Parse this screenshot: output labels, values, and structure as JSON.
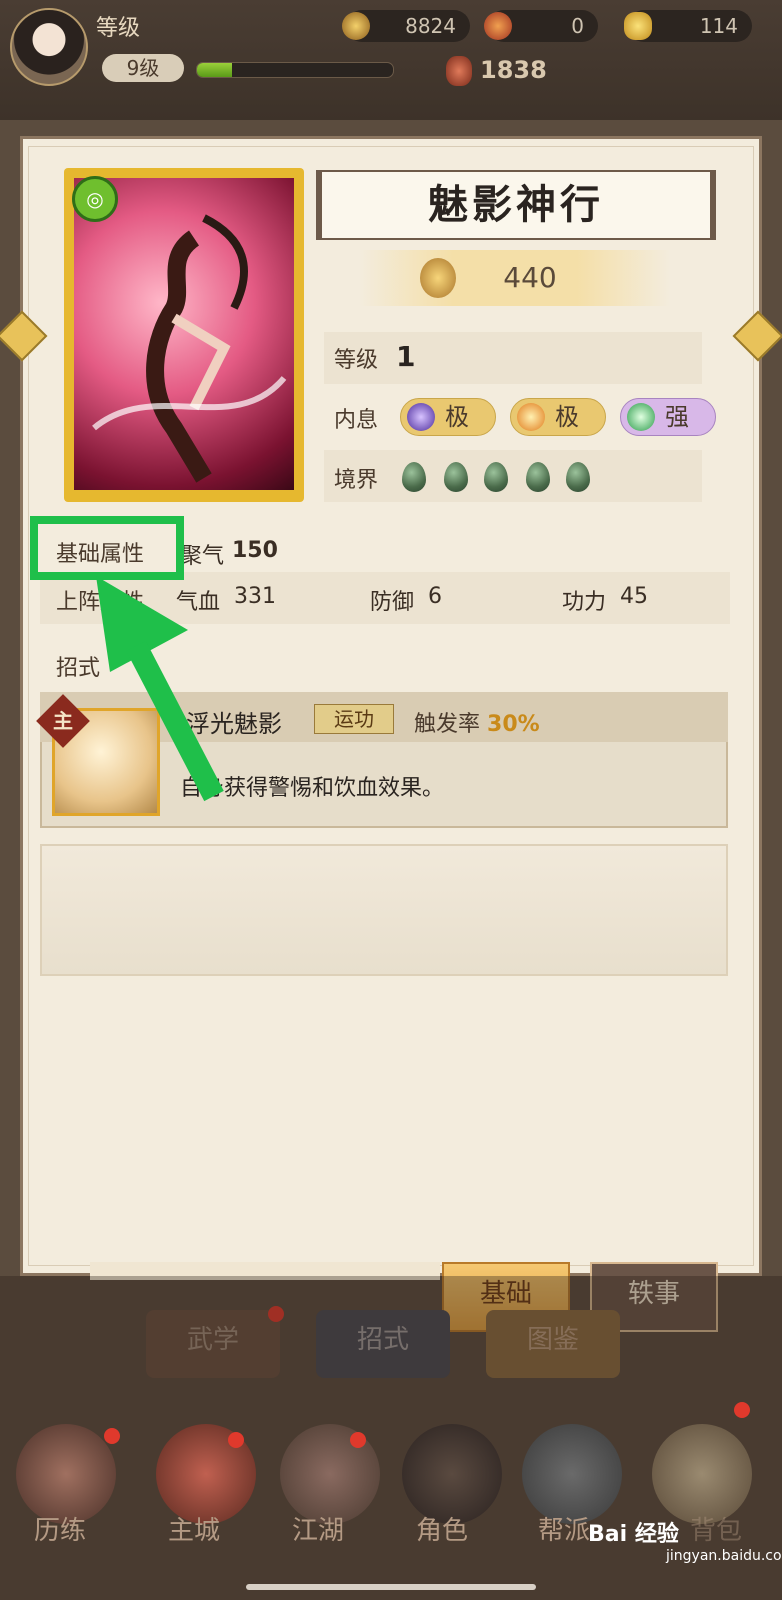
{
  "header": {
    "level_title": "等级",
    "level_value": "9级",
    "xp_progress": 0.18,
    "currency": [
      {
        "icon": "coin-icon",
        "value": "8824"
      },
      {
        "icon": "token-icon",
        "value": "0"
      },
      {
        "icon": "ingot-icon",
        "value": "114"
      }
    ],
    "power_value": "1838"
  },
  "card": {
    "name": "魅影神行",
    "score": "440",
    "level_label": "等级",
    "level_value": "1",
    "inner_label": "内息",
    "inner_badges": [
      {
        "text": "极",
        "color": "#6a4ab8"
      },
      {
        "text": "极",
        "color": "#e08a1a"
      },
      {
        "text": "强",
        "color": "#3abf6a"
      }
    ],
    "realm_label": "境界",
    "realm_count": 5
  },
  "attributes": {
    "base_label": "基础属性",
    "base_stat_name": "聚气",
    "base_stat_value": "150",
    "deploy_label": "上阵属性",
    "deploy_stats": [
      {
        "name": "气血",
        "value": "331"
      },
      {
        "name": "防御",
        "value": "6"
      },
      {
        "name": "功力",
        "value": "45"
      }
    ]
  },
  "moves": {
    "title": "招式",
    "skill": {
      "badge": "主",
      "name": "浮光魅影",
      "tag": "运功",
      "rate_label": "触发率",
      "rate_value": "30%",
      "desc": "自身获得警惕和饮血效果。"
    }
  },
  "tabs": {
    "basic": "基础",
    "story": "轶事"
  },
  "sub_buttons": [
    "武学",
    "招式",
    "图鉴"
  ],
  "nav": [
    "历练",
    "主城",
    "江湖",
    "角色",
    "帮派",
    "背包"
  ],
  "watermark": {
    "logo": "Bai 经验",
    "url": "jingyan.baidu.com"
  }
}
